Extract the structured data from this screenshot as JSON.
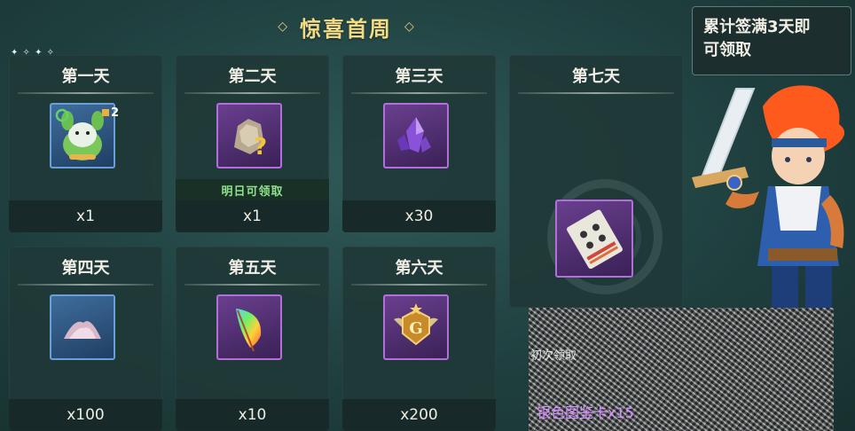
{
  "header": {
    "title": "惊喜首周"
  },
  "tooltip": {
    "line1": "累计签满3天即",
    "line2": "可领取"
  },
  "days": {
    "d1": {
      "label": "第一天",
      "qty": "x1",
      "badge": "2"
    },
    "d2": {
      "label": "第二天",
      "qty": "x1",
      "status": "明日可领取"
    },
    "d3": {
      "label": "第三天",
      "qty": "x30"
    },
    "d4": {
      "label": "第四天",
      "qty": "x100"
    },
    "d5": {
      "label": "第五天",
      "qty": "x10"
    },
    "d6": {
      "label": "第六天",
      "qty": "x200"
    },
    "d7": {
      "label": "第七天"
    }
  },
  "overlay": {
    "reward_name": "银色图鉴卡x15",
    "partial_text": "初次领取"
  },
  "colors": {
    "title": "#f4dc86",
    "rare_blue": "#6aa0d8",
    "epic_purple": "#b26ed9",
    "status_green": "#8fe08b",
    "reward_purple": "#d690ff"
  }
}
